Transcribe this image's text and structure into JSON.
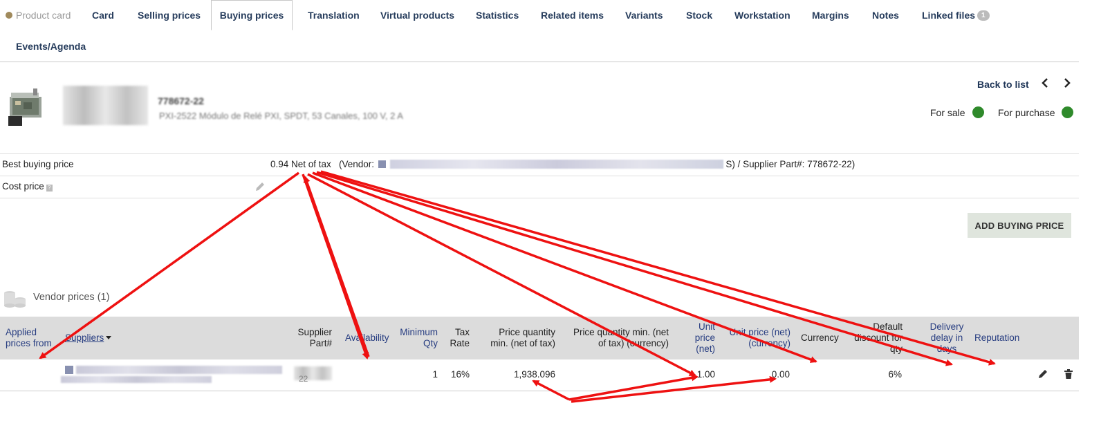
{
  "tabs": [
    {
      "label": "Product card"
    },
    {
      "label": "Card"
    },
    {
      "label": "Selling prices"
    },
    {
      "label": "Buying prices"
    },
    {
      "label": "Translation"
    },
    {
      "label": "Virtual products"
    },
    {
      "label": "Statistics"
    },
    {
      "label": "Related items"
    },
    {
      "label": "Variants"
    },
    {
      "label": "Stock"
    },
    {
      "label": "Workstation"
    },
    {
      "label": "Margins"
    },
    {
      "label": "Notes"
    },
    {
      "label": "Linked files",
      "badge": "1"
    },
    {
      "label": "Events/Agenda"
    }
  ],
  "active_tab": "Buying prices",
  "product": {
    "ref": "778672-22",
    "label": "PXI-2522 Módulo de Relé PXI, SPDT, 53 Canales, 100 V, 2 A"
  },
  "nav": {
    "back_to_list": "Back to list",
    "prev_icon": "chevron-left-icon",
    "next_icon": "chevron-right-icon",
    "for_sale": "For sale",
    "for_purchase": "For purchase",
    "status_color": "#2f8a2b"
  },
  "prices": {
    "best_label": "Best buying price",
    "best_value": "0.94 Net of tax",
    "vendor_prefix": "(Vendor:",
    "vendor_suffix": "S) / Supplier Part#: 778672-22)",
    "cost_label": "Cost price"
  },
  "add_button": "ADD BUYING PRICE",
  "section_title": "Vendor prices (1)",
  "table": {
    "headers": {
      "applied": "Applied prices from",
      "suppliers": "Suppliers",
      "supplier_part": "Supplier Part#",
      "availability": "Availability",
      "min_qty": "Minimum Qty",
      "tax_rate": "Tax Rate",
      "price_qty_min": "Price quantity min. (net of tax)",
      "price_qty_min_cur": "Price quantity min. (net of tax) (currency)",
      "unit_price": "Unit price (net)",
      "unit_price_cur": "Unit price (net) (currency)",
      "currency": "Currency",
      "default_discount": "Default discount for qty",
      "delivery_delay": "Delivery delay in days",
      "reputation": "Reputation"
    },
    "rows": [
      {
        "supplier_part": "22",
        "min_qty": "1",
        "tax_rate": "16%",
        "price_qty_min": "1,938.096",
        "unit_price": "1.00",
        "unit_price_cur": "0.00",
        "default_discount": "6%"
      }
    ]
  },
  "annotation_color": "#ee1111"
}
